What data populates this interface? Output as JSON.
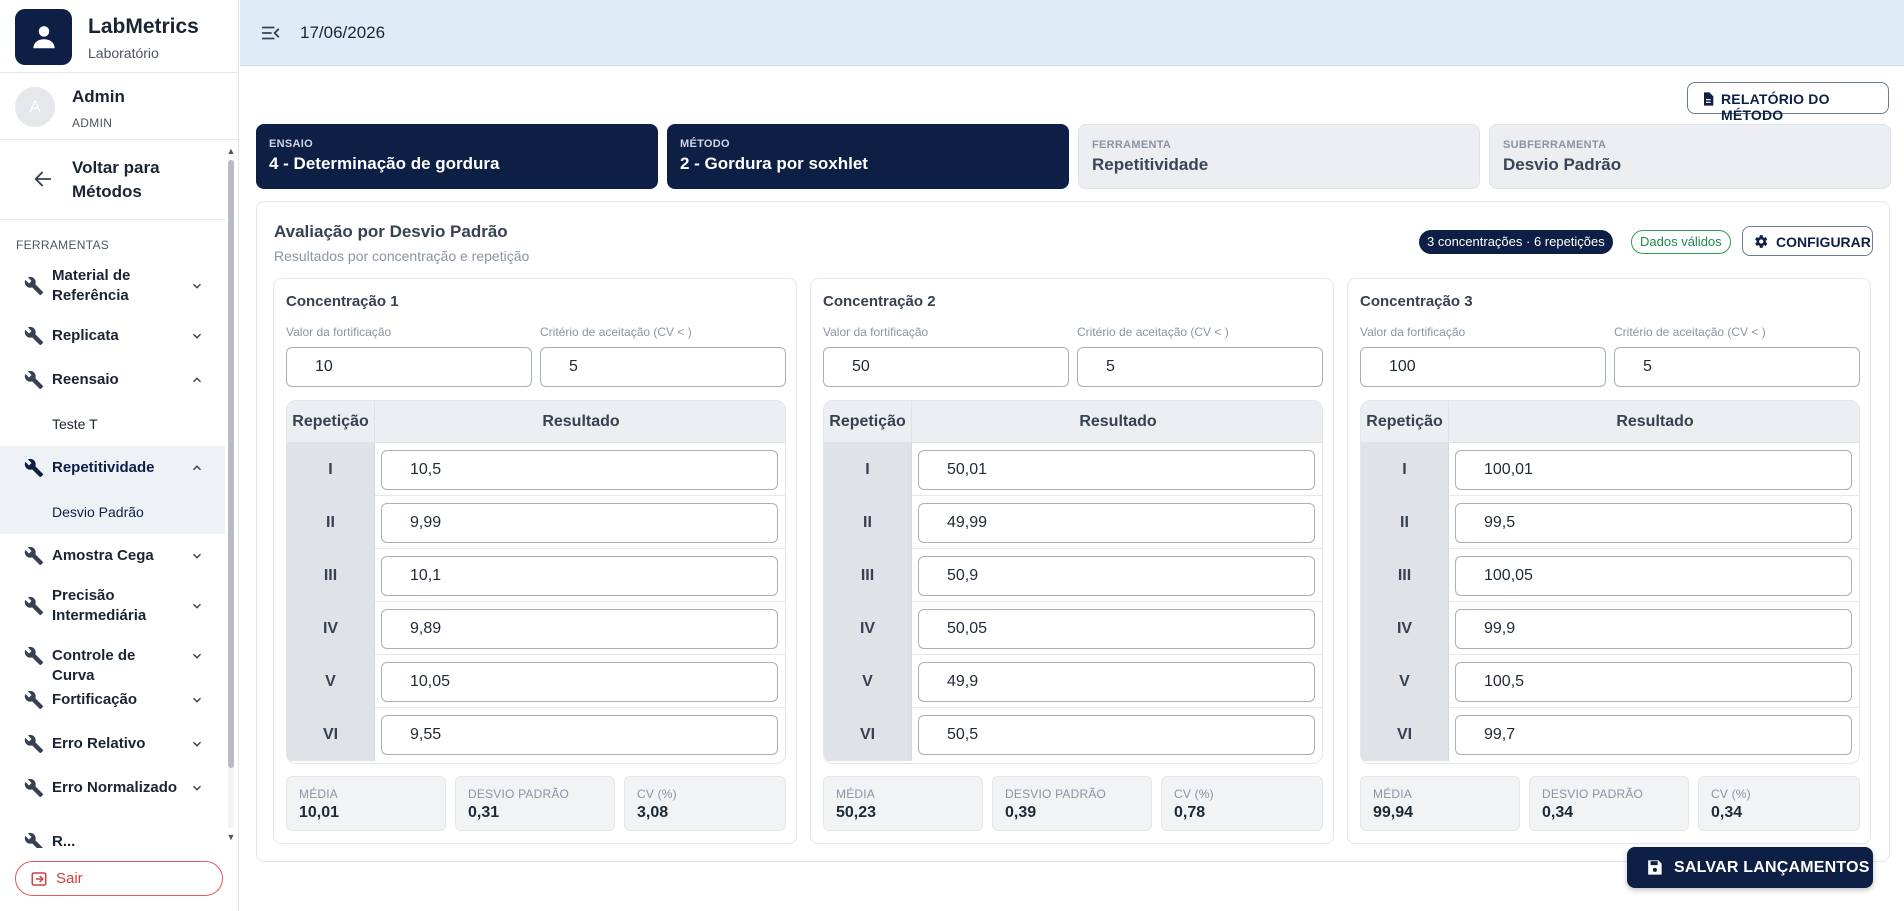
{
  "brand": {
    "name": "LabMetrics",
    "subtitle": "Laboratório"
  },
  "user": {
    "initial": "A",
    "name": "Admin",
    "role": "ADMIN"
  },
  "back": {
    "label": "Voltar para Métodos"
  },
  "sidebar": {
    "section_title": "FERRAMENTAS",
    "items": [
      {
        "label": "Material de Referência",
        "expanded": false
      },
      {
        "label": "Replicata",
        "expanded": false
      },
      {
        "label": "Reensaio",
        "expanded": true,
        "children": [
          "Teste T"
        ]
      },
      {
        "label": "Repetitividade",
        "expanded": true,
        "active": true,
        "children": [
          "Desvio Padrão"
        ]
      },
      {
        "label": "Amostra Cega",
        "expanded": false
      },
      {
        "label": "Precisão Intermediária",
        "expanded": false
      },
      {
        "label": "Controle de Curva",
        "expanded": false
      },
      {
        "label": "Fortificação",
        "expanded": false
      },
      {
        "label": "Erro Relativo",
        "expanded": false
      },
      {
        "label": "Erro Normalizado",
        "expanded": false
      },
      {
        "label": "R...",
        "expanded": false
      }
    ],
    "logout_label": "Sair"
  },
  "header": {
    "date": "17/06/2026"
  },
  "report_button": "RELATÓRIO DO MÉTODO",
  "breadcrumbs": [
    {
      "caption": "ENSAIO",
      "value": "4 - Determinação de gordura"
    },
    {
      "caption": "MÉTODO",
      "value": "2 - Gordura por soxhlet"
    },
    {
      "caption": "FERRAMENTA",
      "value": "Repetitividade"
    },
    {
      "caption": "SUBFERRAMENTA",
      "value": "Desvio Padrão"
    }
  ],
  "panel": {
    "title": "Avaliação por Desvio Padrão",
    "subtitle": "Resultados por concentração e repetição",
    "summary_badge": "3 concentrações · 6 repetições",
    "status_badge": "Dados válidos",
    "config_button": "CONFIGURAR"
  },
  "labels": {
    "fortification": "Valor da fortificação",
    "acceptance": "Critério de aceitação (CV < )",
    "col_rep": "Repetição",
    "col_result": "Resultado",
    "mean": "MÉDIA",
    "stdev": "DESVIO PADRÃO",
    "cv": "CV (%)"
  },
  "concentrations": [
    {
      "title": "Concentração 1",
      "fortification": "10",
      "acceptance": "5",
      "rows": [
        {
          "rep": "I",
          "result": "10,5"
        },
        {
          "rep": "II",
          "result": "9,99"
        },
        {
          "rep": "III",
          "result": "10,1"
        },
        {
          "rep": "IV",
          "result": "9,89"
        },
        {
          "rep": "V",
          "result": "10,05"
        },
        {
          "rep": "VI",
          "result": "9,55"
        }
      ],
      "mean": "10,01",
      "stdev": "0,31",
      "cv": "3,08"
    },
    {
      "title": "Concentração 2",
      "fortification": "50",
      "acceptance": "5",
      "rows": [
        {
          "rep": "I",
          "result": "50,01"
        },
        {
          "rep": "II",
          "result": "49,99"
        },
        {
          "rep": "III",
          "result": "50,9"
        },
        {
          "rep": "IV",
          "result": "50,05"
        },
        {
          "rep": "V",
          "result": "49,9"
        },
        {
          "rep": "VI",
          "result": "50,5"
        }
      ],
      "mean": "50,23",
      "stdev": "0,39",
      "cv": "0,78"
    },
    {
      "title": "Concentração 3",
      "fortification": "100",
      "acceptance": "5",
      "rows": [
        {
          "rep": "I",
          "result": "100,01"
        },
        {
          "rep": "II",
          "result": "99,5"
        },
        {
          "rep": "III",
          "result": "100,05"
        },
        {
          "rep": "IV",
          "result": "99,9"
        },
        {
          "rep": "V",
          "result": "100,5"
        },
        {
          "rep": "VI",
          "result": "99,7"
        }
      ],
      "mean": "99,94",
      "stdev": "0,34",
      "cv": "0,34"
    }
  ],
  "save_button": "SALVAR LANÇAMENTOS",
  "colors": {
    "primary": "#0d1f45",
    "header_bg": "#dfecf7",
    "valid": "#21884a",
    "logout": "#d04040"
  }
}
